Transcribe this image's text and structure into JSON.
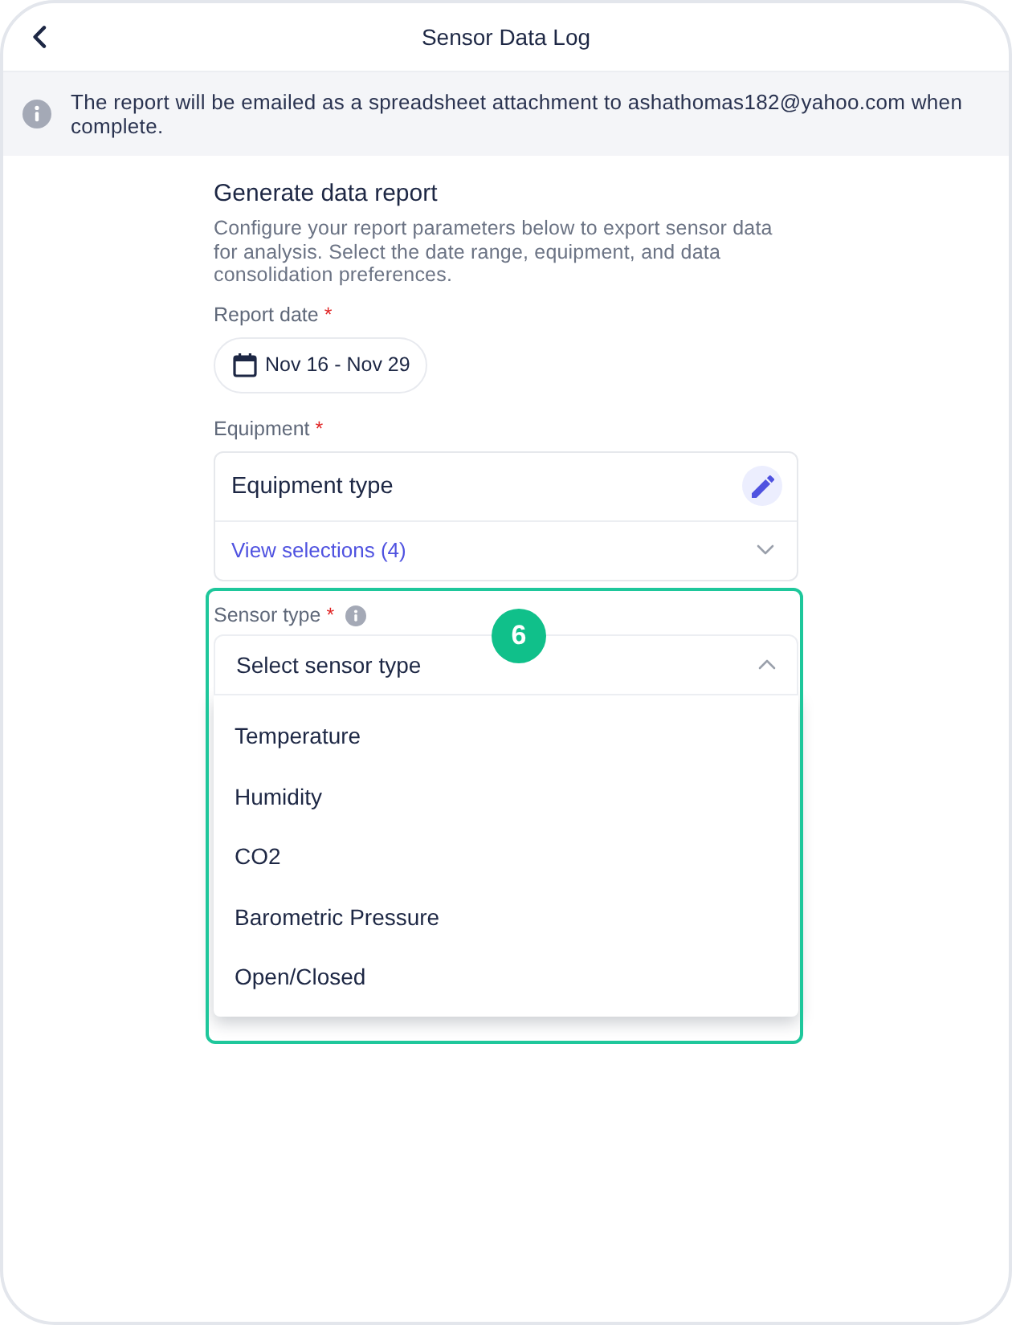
{
  "header": {
    "title": "Sensor Data Log"
  },
  "info_banner": {
    "text": "The report will be emailed as a spreadsheet attachment to ashathomas182@yahoo.com when complete."
  },
  "form": {
    "title": "Generate data report",
    "description": "Configure your report parameters below to export sensor data for analysis. Select the date range, equipment, and data consolidation preferences.",
    "report_date": {
      "label": "Report date",
      "required_mark": "*",
      "value": "Nov 16 - Nov 29"
    },
    "equipment": {
      "label": "Equipment",
      "required_mark": "*",
      "value": "Equipment type",
      "link": "View selections (4)"
    },
    "sensor_type": {
      "label": "Sensor type",
      "required_mark": "*",
      "placeholder": "Select sensor type",
      "expanded": true,
      "options": [
        {
          "label": "Temperature",
          "selected": false
        },
        {
          "label": "Humidity",
          "selected": false
        },
        {
          "label": "CO2",
          "selected": false
        },
        {
          "label": "Barometric Pressure",
          "selected": false
        },
        {
          "label": "Open/Closed",
          "selected": false
        }
      ]
    }
  },
  "annotation": {
    "label": "6"
  }
}
